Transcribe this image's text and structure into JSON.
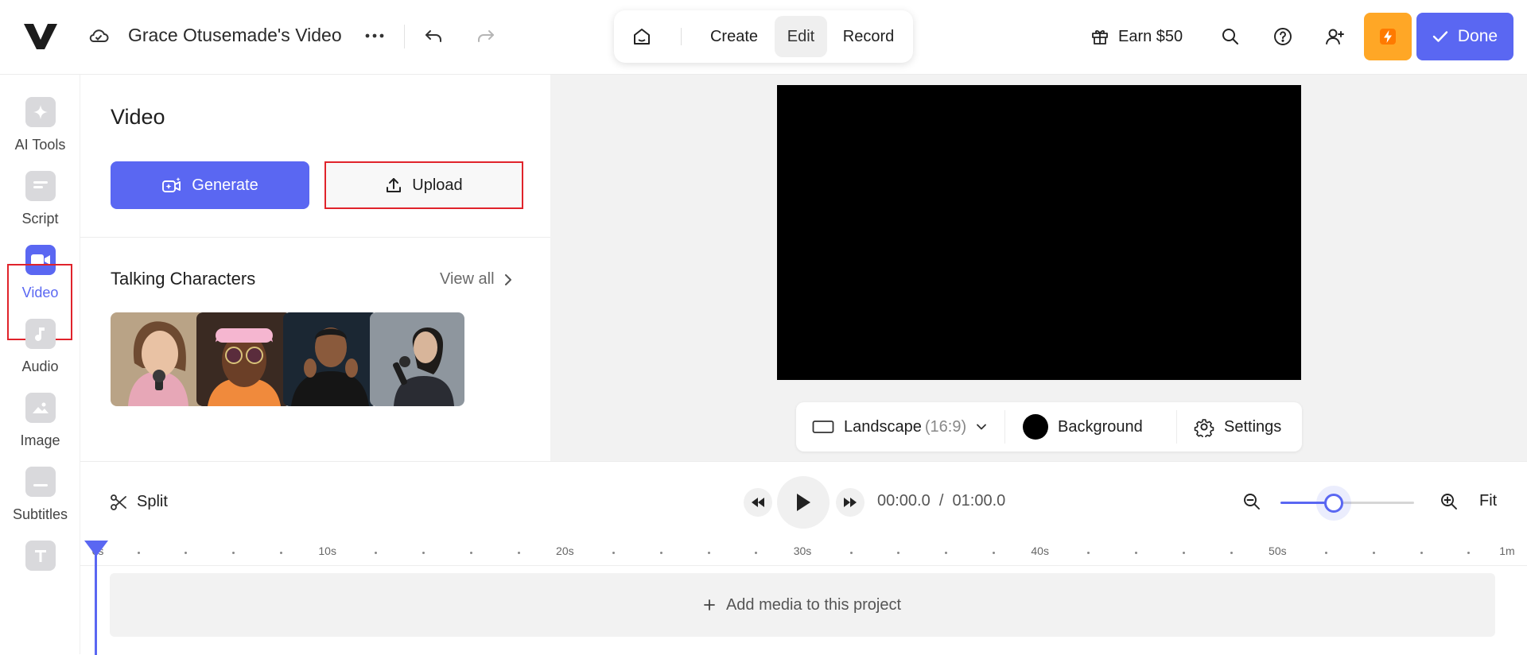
{
  "header": {
    "logo": "V",
    "project_title": "Grace Otusemade's Video",
    "mode_tabs": [
      "Create",
      "Edit",
      "Record"
    ],
    "active_mode": "Edit",
    "earn_label": "Earn $50",
    "done_label": "Done",
    "icons": [
      "cloud-icon",
      "more-icon",
      "undo-icon",
      "redo-icon",
      "home-icon",
      "gift-icon",
      "search-icon",
      "help-icon",
      "invite-user-icon",
      "lightning-icon",
      "checkmark-icon"
    ],
    "colors": {
      "accent": "#5a67f2",
      "boost": "#ffa726",
      "highlight_border": "#e0232b"
    }
  },
  "sidebar": {
    "items": [
      {
        "label": "AI Tools",
        "icon": "sparkle-icon"
      },
      {
        "label": "Script",
        "icon": "script-icon"
      },
      {
        "label": "Video",
        "icon": "video-camera-icon",
        "active": true
      },
      {
        "label": "Audio",
        "icon": "music-note-icon"
      },
      {
        "label": "Image",
        "icon": "image-icon"
      },
      {
        "label": "Subtitles",
        "icon": "subtitles-icon"
      }
    ]
  },
  "panel": {
    "title": "Video",
    "generate_label": "Generate",
    "upload_label": "Upload",
    "talking_characters": {
      "title": "Talking Characters",
      "view_all_label": "View all",
      "thumbnail_count": 4
    }
  },
  "canvas": {
    "orientation_label": "Landscape",
    "ratio_label": "(16:9)",
    "background_label": "Background",
    "background_color": "#000000",
    "settings_label": "Settings"
  },
  "timeline": {
    "split_label": "Split",
    "current_time": "00:00.0",
    "separator": "/",
    "total_time": "01:00.0",
    "fit_label": "Fit",
    "zoom_level": 0.4,
    "ruler_labels": [
      "0s",
      "10s",
      "20s",
      "30s",
      "40s",
      "50s",
      "1m"
    ],
    "add_media_label": "Add media to this project"
  }
}
